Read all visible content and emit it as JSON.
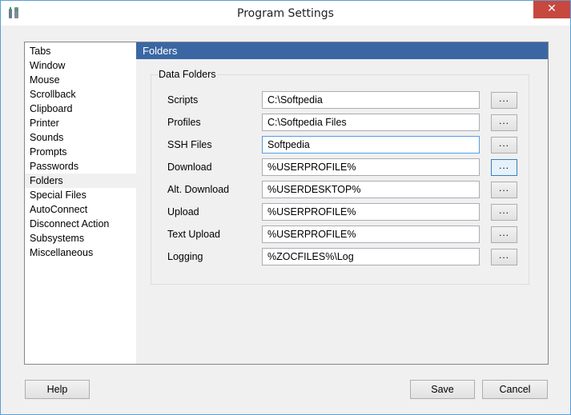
{
  "window": {
    "title": "Program Settings",
    "close_label": "✕"
  },
  "sidebar": {
    "items": [
      {
        "label": "Tabs"
      },
      {
        "label": "Window"
      },
      {
        "label": "Mouse"
      },
      {
        "label": "Scrollback"
      },
      {
        "label": "Clipboard"
      },
      {
        "label": "Printer"
      },
      {
        "label": "Sounds"
      },
      {
        "label": "Prompts"
      },
      {
        "label": "Passwords"
      },
      {
        "label": "Folders",
        "selected": true
      },
      {
        "label": "Special Files"
      },
      {
        "label": "AutoConnect"
      },
      {
        "label": "Disconnect Action"
      },
      {
        "label": "Subsystems"
      },
      {
        "label": "Miscellaneous"
      }
    ]
  },
  "panel": {
    "header": "Folders",
    "group_label": "Data Folders",
    "rows": [
      {
        "label": "Scripts",
        "value": "C:\\Softpedia",
        "button": "..."
      },
      {
        "label": "Profiles",
        "value": "C:\\Softpedia Files",
        "button": "..."
      },
      {
        "label": "SSH Files",
        "value": "Softpedia",
        "button": "..."
      },
      {
        "label": "Download",
        "value": "%USERPROFILE%",
        "button": "..."
      },
      {
        "label": "Alt. Download",
        "value": "%USERDESKTOP%",
        "button": "..."
      },
      {
        "label": "Upload",
        "value": "%USERPROFILE%",
        "button": "..."
      },
      {
        "label": "Text Upload",
        "value": "%USERPROFILE%",
        "button": "..."
      },
      {
        "label": "Logging",
        "value": "%ZOCFILES%\\Log",
        "button": "..."
      }
    ]
  },
  "footer": {
    "help_label": "Help",
    "save_label": "Save",
    "cancel_label": "Cancel"
  },
  "colors": {
    "header_bg": "#3a67a3",
    "close_bg": "#c7483f",
    "focus_border": "#569de5"
  }
}
